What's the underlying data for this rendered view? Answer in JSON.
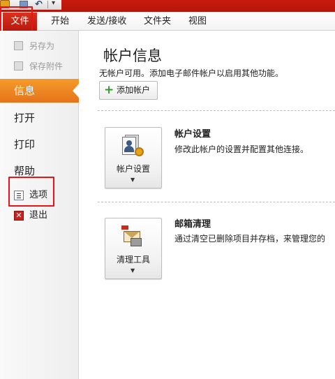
{
  "ribbon": {
    "file_tab": "文件",
    "tabs": [
      "开始",
      "发送/接收",
      "文件夹",
      "视图"
    ]
  },
  "nav": {
    "save_as": "另存为",
    "save_attachments": "保存附件",
    "items": [
      "信息",
      "打开",
      "打印",
      "帮助"
    ],
    "options": "选项",
    "exit": "退出"
  },
  "main": {
    "title": "帐户信息",
    "subtitle": "无帐户可用。添加电子邮件帐户以启用其他功能。",
    "add_account": "添加帐户",
    "account_settings": {
      "button_label": "帐户设置",
      "title": "帐户设置",
      "description": "修改此帐户的设置并配置其他连接。"
    },
    "mailbox_cleanup": {
      "button_label": "清理工具",
      "title": "邮箱清理",
      "description": "通过清空已删除项目并存档，来管理您的"
    }
  },
  "colors": {
    "brand_red": "#c91a0f",
    "active_orange": "#f08a24",
    "highlight_red": "#e8141a"
  }
}
